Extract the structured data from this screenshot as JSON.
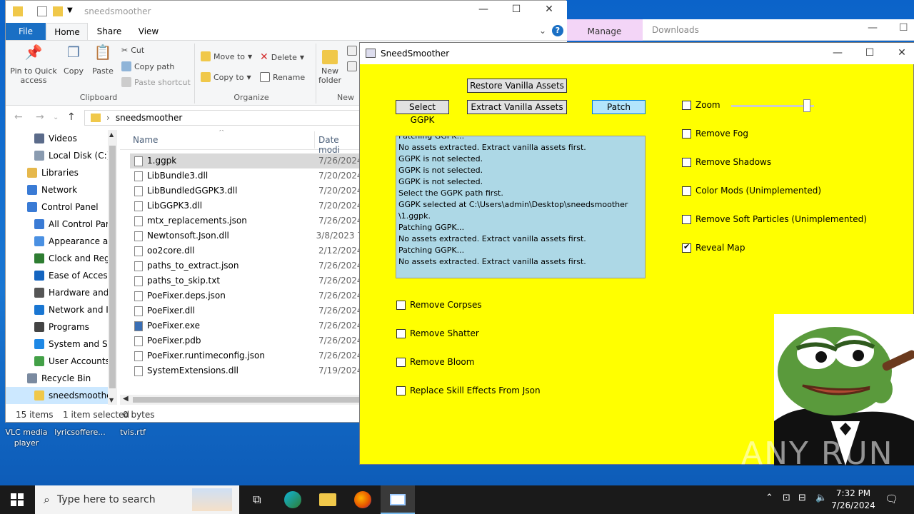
{
  "desktop": {
    "icons": [
      {
        "label_1": "VLC media",
        "label_2": "player"
      },
      {
        "label_1": "lyricsoffere...",
        "label_2": ""
      },
      {
        "label_1": "tvis.rtf",
        "label_2": ""
      }
    ]
  },
  "bg_window": {
    "manage_tab": "Manage",
    "title": "Downloads"
  },
  "explorer": {
    "title": "sneedsmoother",
    "tabs": [
      "File",
      "Home",
      "Share",
      "View"
    ],
    "ribbon": {
      "pin": "Pin to Quick access",
      "copy": "Copy",
      "paste": "Paste",
      "cut": "Cut",
      "copy_path": "Copy path",
      "paste_shortcut": "Paste shortcut",
      "clipboard_group": "Clipboard",
      "move_to": "Move to",
      "copy_to": "Copy to",
      "delete": "Delete",
      "rename": "Rename",
      "organize_group": "Organize",
      "new_folder_1": "New",
      "new_folder_2": "folder",
      "new_group": "New"
    },
    "address": "sneedsmoother",
    "nav_items": [
      {
        "label": "Videos",
        "indent": 1,
        "color": "#5b6b8a"
      },
      {
        "label": "Local Disk (C:)",
        "indent": 1,
        "color": "#8a9bb0"
      },
      {
        "label": "Libraries",
        "indent": 0,
        "color": "#e6b84c"
      },
      {
        "label": "Network",
        "indent": 0,
        "color": "#3a7bd5"
      },
      {
        "label": "Control Panel",
        "indent": 0,
        "color": "#3a7bd5"
      },
      {
        "label": "All Control Par",
        "indent": 1,
        "color": "#3a7bd5"
      },
      {
        "label": "Appearance an",
        "indent": 1,
        "color": "#4a90e2"
      },
      {
        "label": "Clock and Regi",
        "indent": 1,
        "color": "#2e7d32"
      },
      {
        "label": "Ease of Access",
        "indent": 1,
        "color": "#1565c0"
      },
      {
        "label": "Hardware and",
        "indent": 1,
        "color": "#555555"
      },
      {
        "label": "Network and Ir",
        "indent": 1,
        "color": "#1976d2"
      },
      {
        "label": "Programs",
        "indent": 1,
        "color": "#444444"
      },
      {
        "label": "System and Sec",
        "indent": 1,
        "color": "#1e88e5"
      },
      {
        "label": "User Accounts",
        "indent": 1,
        "color": "#43a047"
      },
      {
        "label": "Recycle Bin",
        "indent": 0,
        "color": "#7a8aa0"
      },
      {
        "label": "sneedsmoother",
        "indent": 1,
        "color": "#f0c84a"
      }
    ],
    "columns": {
      "name": "Name",
      "date": "Date modi"
    },
    "files": [
      {
        "name": "1.ggpk",
        "date": "7/26/2024"
      },
      {
        "name": "LibBundle3.dll",
        "date": "7/20/2024"
      },
      {
        "name": "LibBundledGGPK3.dll",
        "date": "7/20/2024"
      },
      {
        "name": "LibGGPK3.dll",
        "date": "7/20/2024"
      },
      {
        "name": "mtx_replacements.json",
        "date": "7/26/2024"
      },
      {
        "name": "Newtonsoft.Json.dll",
        "date": "3/8/2023 7"
      },
      {
        "name": "oo2core.dll",
        "date": "2/12/2024"
      },
      {
        "name": "paths_to_extract.json",
        "date": "7/26/2024"
      },
      {
        "name": "paths_to_skip.txt",
        "date": "7/26/2024"
      },
      {
        "name": "PoeFixer.deps.json",
        "date": "7/26/2024"
      },
      {
        "name": "PoeFixer.dll",
        "date": "7/26/2024"
      },
      {
        "name": "PoeFixer.exe",
        "date": "7/26/2024"
      },
      {
        "name": "PoeFixer.pdb",
        "date": "7/26/2024"
      },
      {
        "name": "PoeFixer.runtimeconfig.json",
        "date": "7/26/2024"
      },
      {
        "name": "SystemExtensions.dll",
        "date": "7/19/2024"
      }
    ],
    "status": {
      "items": "15 items",
      "selected": "1 item selected",
      "size": "0 bytes"
    }
  },
  "sneed": {
    "title": "SneedSmoother",
    "buttons": {
      "restore": "Restore Vanilla Assets",
      "select": "Select GGPK",
      "extract": "Extract Vanilla Assets",
      "patch": "Patch"
    },
    "log": [
      "Patching GGPK...",
      "No assets extracted. Extract vanilla assets first.",
      "GGPK is not selected.",
      "GGPK is not selected.",
      "GGPK is not selected.",
      "Select the GGPK path first.",
      "GGPK selected at C:\\Users\\admin\\Desktop\\sneedsmoother",
      "\\1.ggpk.",
      "Patching GGPK...",
      "No assets extracted. Extract vanilla assets first.",
      "Patching GGPK...",
      "No assets extracted. Extract vanilla assets first."
    ],
    "right_options": [
      {
        "label": "Zoom",
        "checked": false
      },
      {
        "label": "Remove Fog",
        "checked": false
      },
      {
        "label": "Remove Shadows",
        "checked": false
      },
      {
        "label": "Color Mods (Unimplemented)",
        "checked": false
      },
      {
        "label": "Remove Soft Particles (Unimplemented)",
        "checked": false
      },
      {
        "label": "Reveal Map",
        "checked": true
      }
    ],
    "left_options": [
      {
        "label": "Remove Corpses",
        "checked": false
      },
      {
        "label": "Remove Shatter",
        "checked": false
      },
      {
        "label": "Remove Bloom",
        "checked": false
      },
      {
        "label": "Replace Skill Effects From Json",
        "checked": false
      }
    ],
    "zoom_level": 0.95
  },
  "watermark": "ANY RUN",
  "taskbar": {
    "search_placeholder": "Type here to search",
    "time": "7:32 PM",
    "date": "7/26/2024"
  }
}
